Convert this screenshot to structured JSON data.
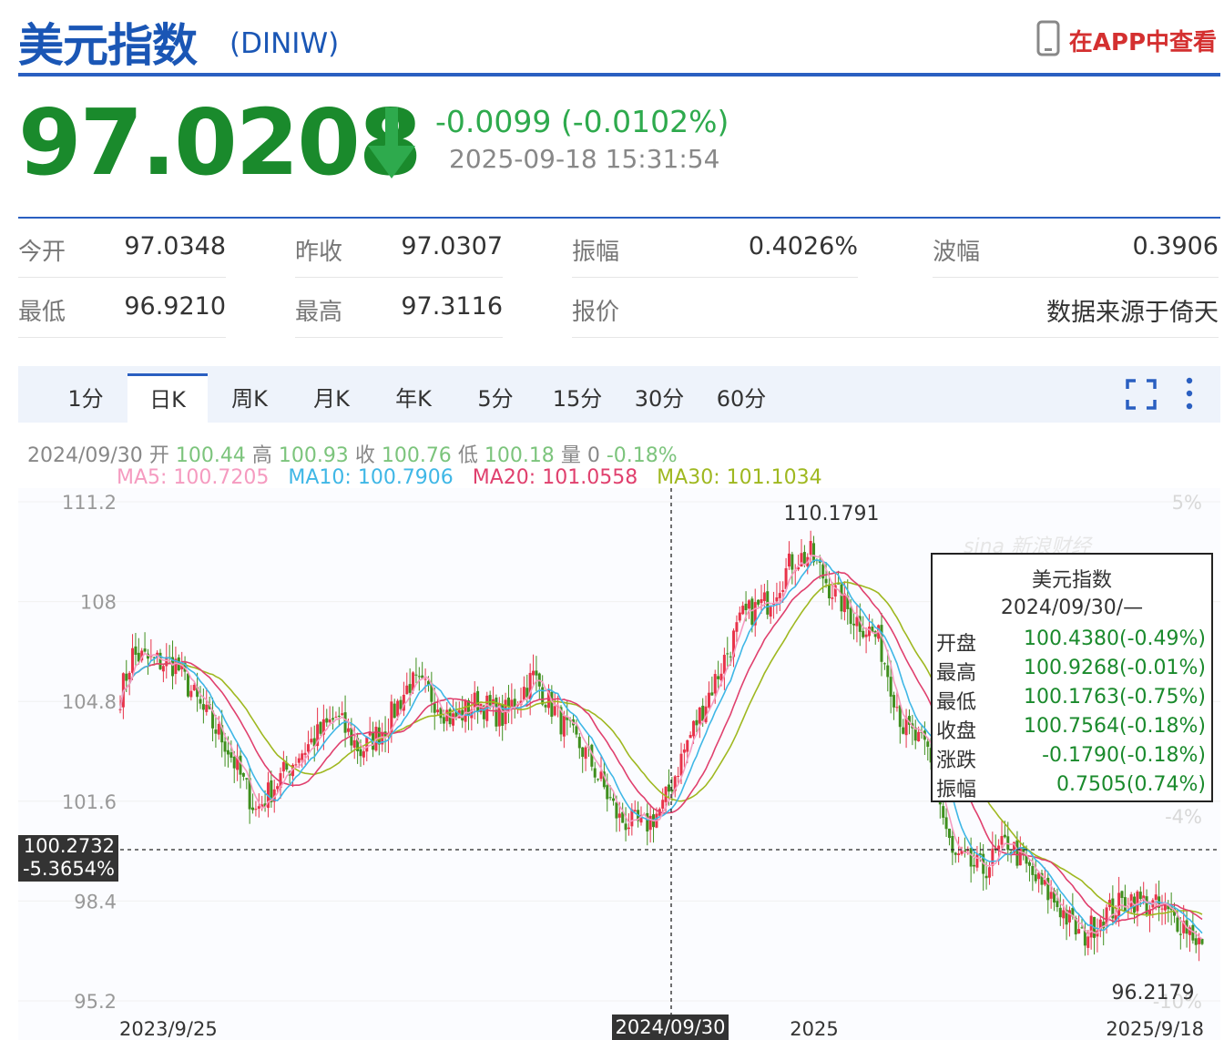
{
  "header": {
    "title": "美元指数",
    "code": "(DINIW)",
    "app_link": "在APP中查看"
  },
  "quote": {
    "price": "97.0208",
    "change": "-0.0099 (-0.0102%)",
    "time": "2025-09-18 15:31:54"
  },
  "stats": {
    "open_label": "今开",
    "open_value": "97.0348",
    "prev_close_label": "昨收",
    "prev_close_value": "97.0307",
    "amplitude_label": "振幅",
    "amplitude_value": "0.4026%",
    "range_label": "波幅",
    "range_value": "0.3906",
    "low_label": "最低",
    "low_value": "96.9210",
    "high_label": "最高",
    "high_value": "97.3116",
    "quote_label": "报价",
    "source": "数据来源于倚天"
  },
  "tabs": [
    {
      "label": "1分"
    },
    {
      "label": "日K"
    },
    {
      "label": "周K"
    },
    {
      "label": "月K"
    },
    {
      "label": "年K"
    },
    {
      "label": "5分"
    },
    {
      "label": "15分"
    },
    {
      "label": "30分"
    },
    {
      "label": "60分"
    }
  ],
  "active_tab": "日K",
  "info_bar": {
    "date": "2024/09/30",
    "open_label": "开",
    "open": "100.44",
    "high_label": "高",
    "high": "100.93",
    "close_label": "收",
    "close": "100.76",
    "low_label": "低",
    "low": "100.18",
    "volume_label": "量",
    "volume": "0",
    "pct": "-0.18%"
  },
  "ma": [
    {
      "text": "MA5: 100.7205",
      "color": "#f59bc0"
    },
    {
      "text": "MA10: 100.7906",
      "color": "#3fb7e6"
    },
    {
      "text": "MA20: 101.0558",
      "color": "#e0406e"
    },
    {
      "text": "MA30: 101.1034",
      "color": "#9fb820"
    }
  ],
  "colors": {
    "up": "#e8334a",
    "down": "#3f8f1e",
    "accent": "#2a5fc1"
  },
  "chart_data": {
    "type": "candlestick",
    "y_ticks": [
      "111.2",
      "108",
      "104.8",
      "101.6",
      "98.4",
      "95.2"
    ],
    "y_tick_values": [
      111.2,
      108,
      104.8,
      101.6,
      98.4,
      95.2
    ],
    "pct_ticks": [
      "5%",
      "-4%",
      "-10%"
    ],
    "x_labels": [
      "2023/9/25",
      "2025",
      "2025/9/18"
    ],
    "ylim": [
      95.2,
      111.2
    ],
    "max_label": "110.1791",
    "min_label": "96.2179",
    "close_trend": [
      [
        0,
        105.0
      ],
      [
        4,
        106.3
      ],
      [
        10,
        106.1
      ],
      [
        18,
        106.0
      ],
      [
        26,
        104.6
      ],
      [
        34,
        103.5
      ],
      [
        44,
        101.3
      ],
      [
        50,
        102.1
      ],
      [
        58,
        103.1
      ],
      [
        70,
        104.3
      ],
      [
        78,
        103.2
      ],
      [
        86,
        104.0
      ],
      [
        94,
        105.4
      ],
      [
        100,
        105.1
      ],
      [
        108,
        104.2
      ],
      [
        116,
        104.8
      ],
      [
        124,
        104.3
      ],
      [
        134,
        105.6
      ],
      [
        144,
        104.0
      ],
      [
        152,
        103.0
      ],
      [
        162,
        101.0
      ],
      [
        170,
        100.8
      ],
      [
        176,
        101.4
      ],
      [
        184,
        103.5
      ],
      [
        194,
        105.7
      ],
      [
        202,
        107.5
      ],
      [
        210,
        108.0
      ],
      [
        218,
        109.3
      ],
      [
        224,
        109.5
      ],
      [
        230,
        108.5
      ],
      [
        238,
        107.5
      ],
      [
        246,
        106.8
      ],
      [
        254,
        104.0
      ],
      [
        262,
        103.2
      ],
      [
        270,
        99.8
      ],
      [
        280,
        99.4
      ],
      [
        288,
        100.3
      ],
      [
        296,
        99.2
      ],
      [
        304,
        98.3
      ],
      [
        312,
        97.2
      ],
      [
        318,
        97.9
      ],
      [
        328,
        98.5
      ],
      [
        336,
        98.2
      ],
      [
        346,
        97.6
      ],
      [
        351,
        97.0
      ]
    ],
    "crosshair": {
      "date": "2024/09/30",
      "price": "100.2732",
      "pct": "-5.3654%"
    },
    "tooltip": {
      "title": "美元指数",
      "date": "2024/09/30/—",
      "rows": [
        {
          "k": "开盘",
          "v": "100.4380(-0.49%)"
        },
        {
          "k": "最高",
          "v": "100.9268(-0.01%)"
        },
        {
          "k": "最低",
          "v": "100.1763(-0.75%)"
        },
        {
          "k": "收盘",
          "v": "100.7564(-0.18%)"
        },
        {
          "k": "涨跌",
          "v": "-0.1790(-0.18%)"
        },
        {
          "k": "振幅",
          "v": "0.7505(0.74%)"
        }
      ]
    }
  }
}
